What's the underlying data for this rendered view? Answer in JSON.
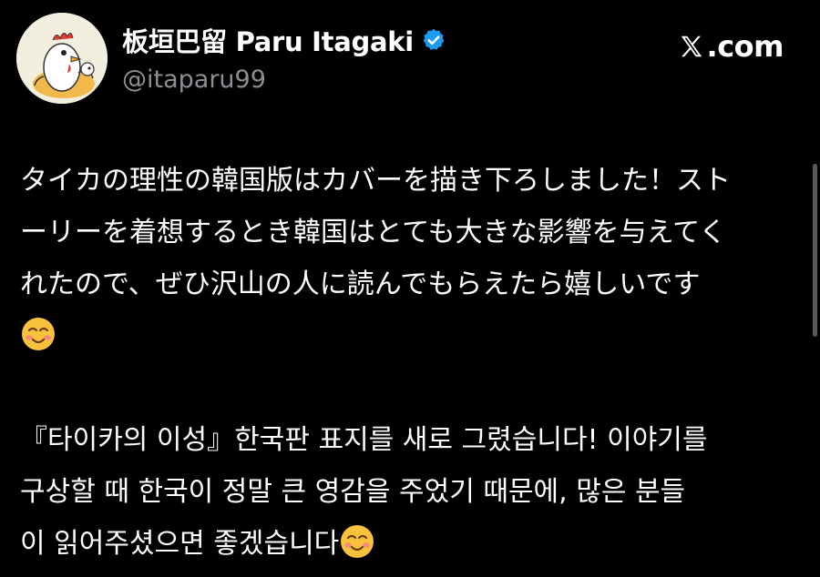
{
  "author": {
    "display_name": "板垣巴留 Paru Itagaki",
    "handle": "@itaparu99",
    "verified": true,
    "avatar": "rooster-avatar"
  },
  "site": {
    "label": ".com",
    "logo": "x-logo-icon"
  },
  "post": {
    "jp_lines": [
      "タイカの理性の韓国版はカバーを描き下ろしました！スト",
      "ーリーを着想するとき韓国はとても大きな影響を与えてく",
      "れたので、ぜひ沢山の人に読んでもらえたら嬉しいです"
    ],
    "kr_lines": [
      "『타이카의 이성』한국판 표지를 새로 그렸습니다! 이야기를",
      "구상할 때 한국이 정말 큰 영감을 주었기 때문에, 많은 분들",
      "이 읽어주셨으면 좋겠습니다"
    ],
    "emoji": "smiling-face-icon"
  },
  "colors": {
    "background": "#000000",
    "text": "#ffffff",
    "handle": "#8b8f94",
    "verified": "#1d9bf0"
  }
}
